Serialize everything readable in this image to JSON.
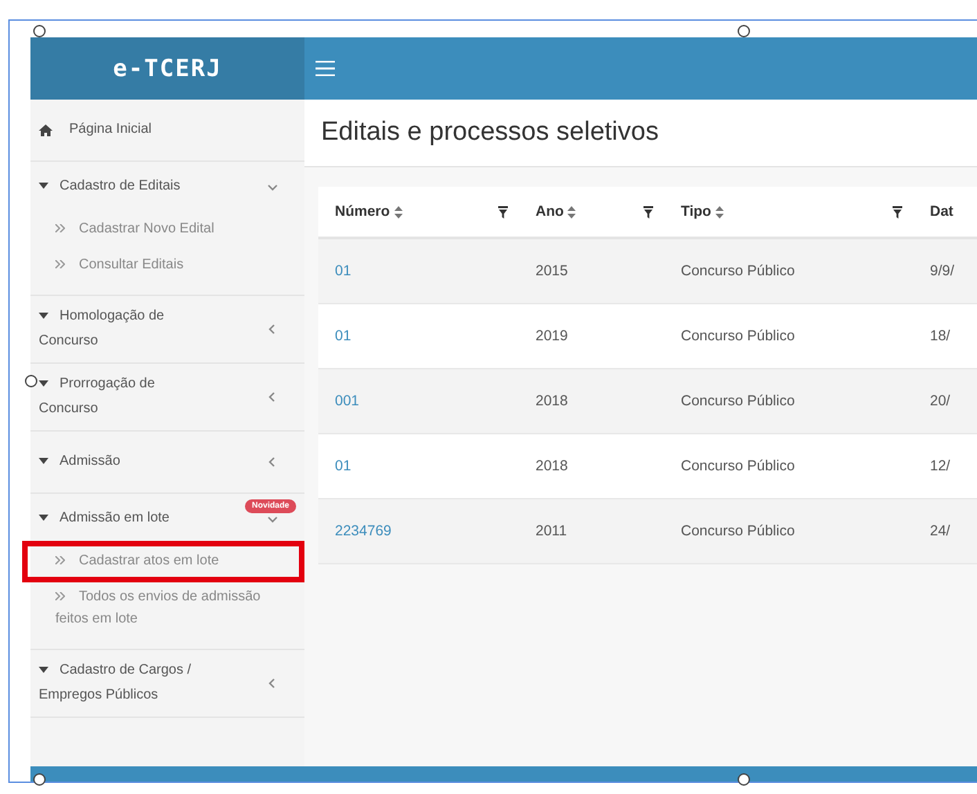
{
  "app": {
    "logo": "e-TCERJ"
  },
  "sidebar": {
    "items": [
      {
        "kind": "link",
        "label": "Página Inicial"
      },
      {
        "kind": "group",
        "label": "Cadastro de Editais",
        "expanded": true,
        "children": [
          {
            "label": "Cadastrar Novo Edital",
            "highlighted": false
          },
          {
            "label": "Consultar Editais",
            "highlighted": false
          }
        ]
      },
      {
        "kind": "group",
        "label": "Homologação de Concurso",
        "expanded": false
      },
      {
        "kind": "group",
        "label": "Prorrogação de Concurso",
        "expanded": false
      },
      {
        "kind": "group",
        "label": "Admissão",
        "expanded": false
      },
      {
        "kind": "group",
        "label": "Admissão em lote",
        "expanded": true,
        "badge": "Novidade",
        "children": [
          {
            "label": "Cadastrar atos em lote",
            "highlighted": true
          },
          {
            "label": "Todos os envios de admissão feitos em lote",
            "highlighted": false
          }
        ]
      },
      {
        "kind": "group",
        "label": "Cadastro de Cargos / Empregos Públicos",
        "expanded": false
      }
    ]
  },
  "page_title": "Editais e processos seletivos",
  "table": {
    "columns": [
      {
        "label": "Número",
        "sortable": true,
        "filter": true
      },
      {
        "label": "Ano",
        "sortable": true,
        "filter": true
      },
      {
        "label": "Tipo",
        "sortable": true,
        "filter": true
      },
      {
        "label": "Dat"
      }
    ],
    "rows": [
      {
        "cells": [
          "01",
          "2015",
          "Concurso Público",
          "9/9/"
        ]
      },
      {
        "cells": [
          "01",
          "2019",
          "Concurso Público",
          "18/"
        ]
      },
      {
        "cells": [
          "001",
          "2018",
          "Concurso Público",
          "20/"
        ]
      },
      {
        "cells": [
          "01",
          "2018",
          "Concurso Público",
          "12/"
        ]
      },
      {
        "cells": [
          "2234769",
          "2011",
          "Concurso Público",
          "24/"
        ]
      }
    ]
  }
}
